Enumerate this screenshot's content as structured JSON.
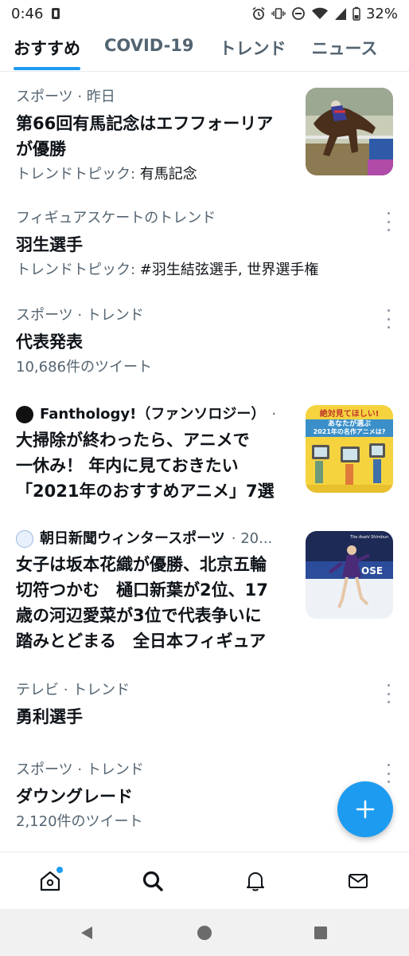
{
  "status_bar": {
    "time": "0:46",
    "battery": "32%"
  },
  "tabs": [
    {
      "label": "おすすめ",
      "active": true
    },
    {
      "label": "COVID-19",
      "active": false
    },
    {
      "label": "トレンド",
      "active": false
    },
    {
      "label": "ニュース",
      "active": false
    }
  ],
  "feed": {
    "item1": {
      "meta": "スポーツ · 昨日",
      "title_line1": "第66回有馬記念はエフフォーリア",
      "title_line2": "が優勝",
      "sub_prefix": "トレンドトピック: ",
      "sub_value": "有馬記念"
    },
    "item2": {
      "meta": "フィギュアスケートのトレンド",
      "title": "羽生選手",
      "sub_prefix": "トレンドトピック: ",
      "sub_value": "#羽生結弦選手, 世界選手権"
    },
    "item3": {
      "meta": "スポーツ · トレンド",
      "title": "代表発表",
      "sub": "10,686件のツイート"
    },
    "item4": {
      "source": "Fanthology!（ファンソロジー）",
      "source_suffix": "·",
      "title_line1": "大掃除が終わったら、アニメで",
      "title_line2": "一休み！ 年内に見ておきたい",
      "title_line3": "「2021年のおすすめアニメ」7選",
      "thumb_text_top": "絶対見てほしい!",
      "thumb_text_mid": "あなたが選ぶ",
      "thumb_text_bottom": "2021年の名作アニメは?"
    },
    "item5": {
      "source": "朝日新聞ウィンタースポーツ",
      "source_suffix": "· 20...",
      "title_line1": "女子は坂本花織が優勝、北京五輪",
      "title_line2": "切符つかむ　樋口新葉が2位、17",
      "title_line3": "歳の河辺愛菜が3位で代表争いに",
      "title_line4": "踏みとどまる　全日本フィギュア",
      "thumb_caption": "The Asahi Shimbun"
    },
    "item6": {
      "meta": "テレビ · トレンド",
      "title": "勇利選手"
    },
    "item7": {
      "meta": "スポーツ · トレンド",
      "title": "ダウングレード",
      "sub": "2,120件のツイート"
    }
  },
  "colors": {
    "accent": "#1d9bf0",
    "text_primary": "#0f1419",
    "text_secondary": "#536471"
  },
  "icons": {
    "fab": "plus-icon",
    "nav": [
      "home-icon",
      "search-icon",
      "bell-icon",
      "mail-icon"
    ]
  }
}
